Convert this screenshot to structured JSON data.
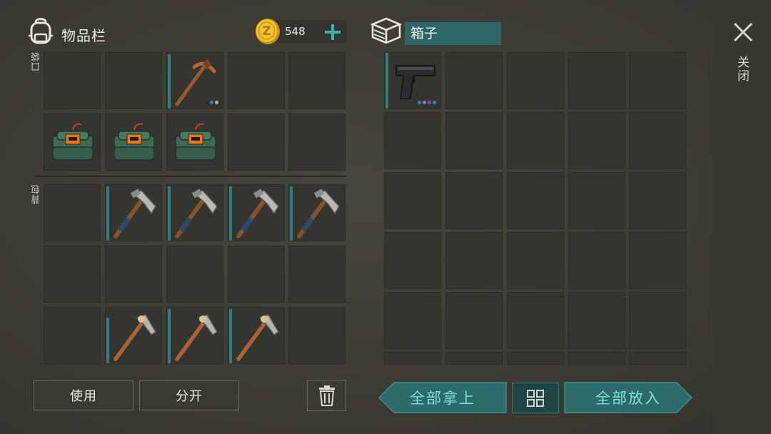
{
  "inventory": {
    "title": "物品栏",
    "coins": "548",
    "pocket_label": "口袋",
    "backpack_label": "背包",
    "pocket_items": [
      {
        "icon": "empty"
      },
      {
        "icon": "empty"
      },
      {
        "icon": "pickaxe-copper-icon",
        "rarity": true
      },
      {
        "icon": "empty"
      },
      {
        "icon": "empty"
      },
      {
        "icon": "c4-explosive-icon"
      },
      {
        "icon": "c4-explosive-icon"
      },
      {
        "icon": "c4-explosive-icon"
      },
      {
        "icon": "empty"
      },
      {
        "icon": "empty"
      }
    ],
    "backpack_items": [
      {
        "icon": "empty"
      },
      {
        "icon": "hammer-axe-icon"
      },
      {
        "icon": "hammer-axe-icon"
      },
      {
        "icon": "hammer-axe-icon"
      },
      {
        "icon": "hammer-axe-icon"
      },
      {
        "icon": "empty"
      },
      {
        "icon": "empty"
      },
      {
        "icon": "empty"
      },
      {
        "icon": "empty"
      },
      {
        "icon": "empty"
      },
      {
        "icon": "empty"
      },
      {
        "icon": "stone-pickaxe-icon"
      },
      {
        "icon": "stone-pickaxe-icon"
      },
      {
        "icon": "stone-pickaxe-icon"
      },
      {
        "icon": "empty"
      }
    ]
  },
  "box": {
    "name": "箱子",
    "items": [
      {
        "icon": "pistol-icon",
        "rarity": true
      }
    ]
  },
  "actions": {
    "use_label": "使用",
    "split_label": "分开",
    "take_all_label": "全部拿上",
    "put_all_label": "全部放入"
  },
  "close_label": "关闭",
  "colors": {
    "accent": "#2f7f80",
    "button_teal": "#2b6b6a",
    "coin": "#e8b21c",
    "plus": "#39b3a8"
  }
}
